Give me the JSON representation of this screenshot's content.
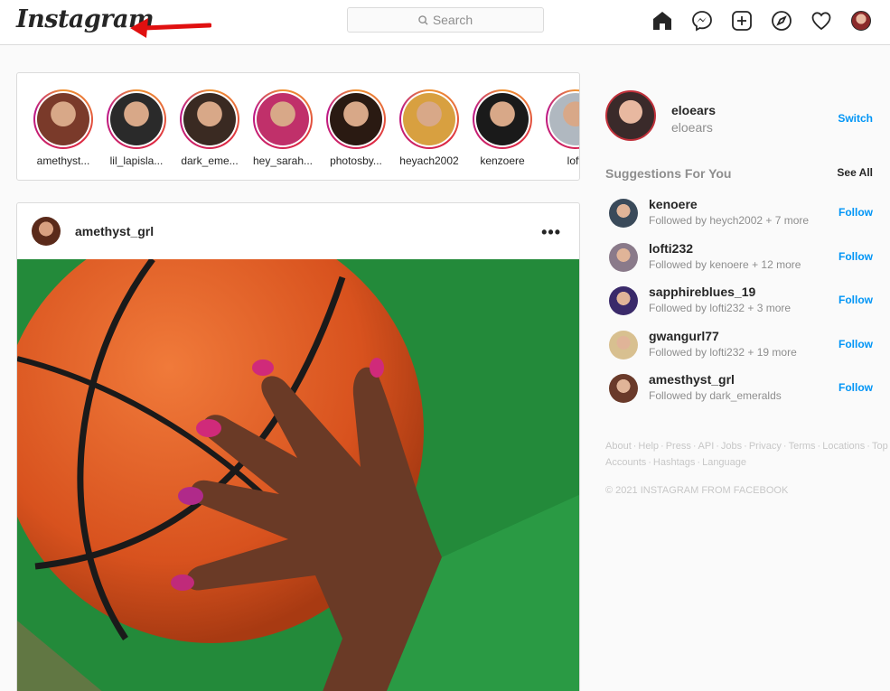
{
  "header": {
    "logo": "Instagram",
    "search_placeholder": "Search",
    "icons": [
      "home-icon",
      "messenger-icon",
      "new-post-icon",
      "explore-icon",
      "activity-heart-icon",
      "profile-avatar"
    ]
  },
  "stories": [
    {
      "name": "amethyst...",
      "color": "#7a3a2a"
    },
    {
      "name": "lil_lapisla...",
      "color": "#2a2a2a"
    },
    {
      "name": "dark_eme...",
      "color": "#3a2a22"
    },
    {
      "name": "hey_sarah...",
      "color": "#c0306a"
    },
    {
      "name": "photosby...",
      "color": "#2a1a12"
    },
    {
      "name": "heyach2002",
      "color": "#d8a040"
    },
    {
      "name": "kenzoere",
      "color": "#1a1a1a"
    },
    {
      "name": "lofti",
      "color": "#b0b8c0"
    }
  ],
  "post": {
    "username": "amethyst_grl",
    "more_label": "•••"
  },
  "sidebar": {
    "username": "eloears",
    "fullname": "eloears",
    "switch_label": "Switch",
    "suggestions_title": "Suggestions For You",
    "see_all_label": "See All",
    "suggestions": [
      {
        "username": "kenoere",
        "sub": "Followed by heych2002 + 7 more",
        "follow": "Follow",
        "color": "#3a4a5a"
      },
      {
        "username": "lofti232",
        "sub": "Followed by kenoere + 12 more",
        "follow": "Follow",
        "color": "#8a7a8a"
      },
      {
        "username": "sapphireblues_19",
        "sub": "Followed by lofti232 + 3 more",
        "follow": "Follow",
        "color": "#3a2a6a"
      },
      {
        "username": "gwangurl77",
        "sub": "Followed by lofti232 + 19 more",
        "follow": "Follow",
        "color": "#d8c090"
      },
      {
        "username": "amesthyst_grl",
        "sub": "Followed by dark_emeralds",
        "follow": "Follow",
        "color": "#6a3a2a"
      }
    ],
    "footer_links": [
      "About",
      "Help",
      "Press",
      "API",
      "Jobs",
      "Privacy",
      "Terms",
      "Locations",
      "Top Accounts",
      "Hashtags",
      "Language"
    ],
    "copyright": "© 2021 Instagram from Facebook"
  }
}
